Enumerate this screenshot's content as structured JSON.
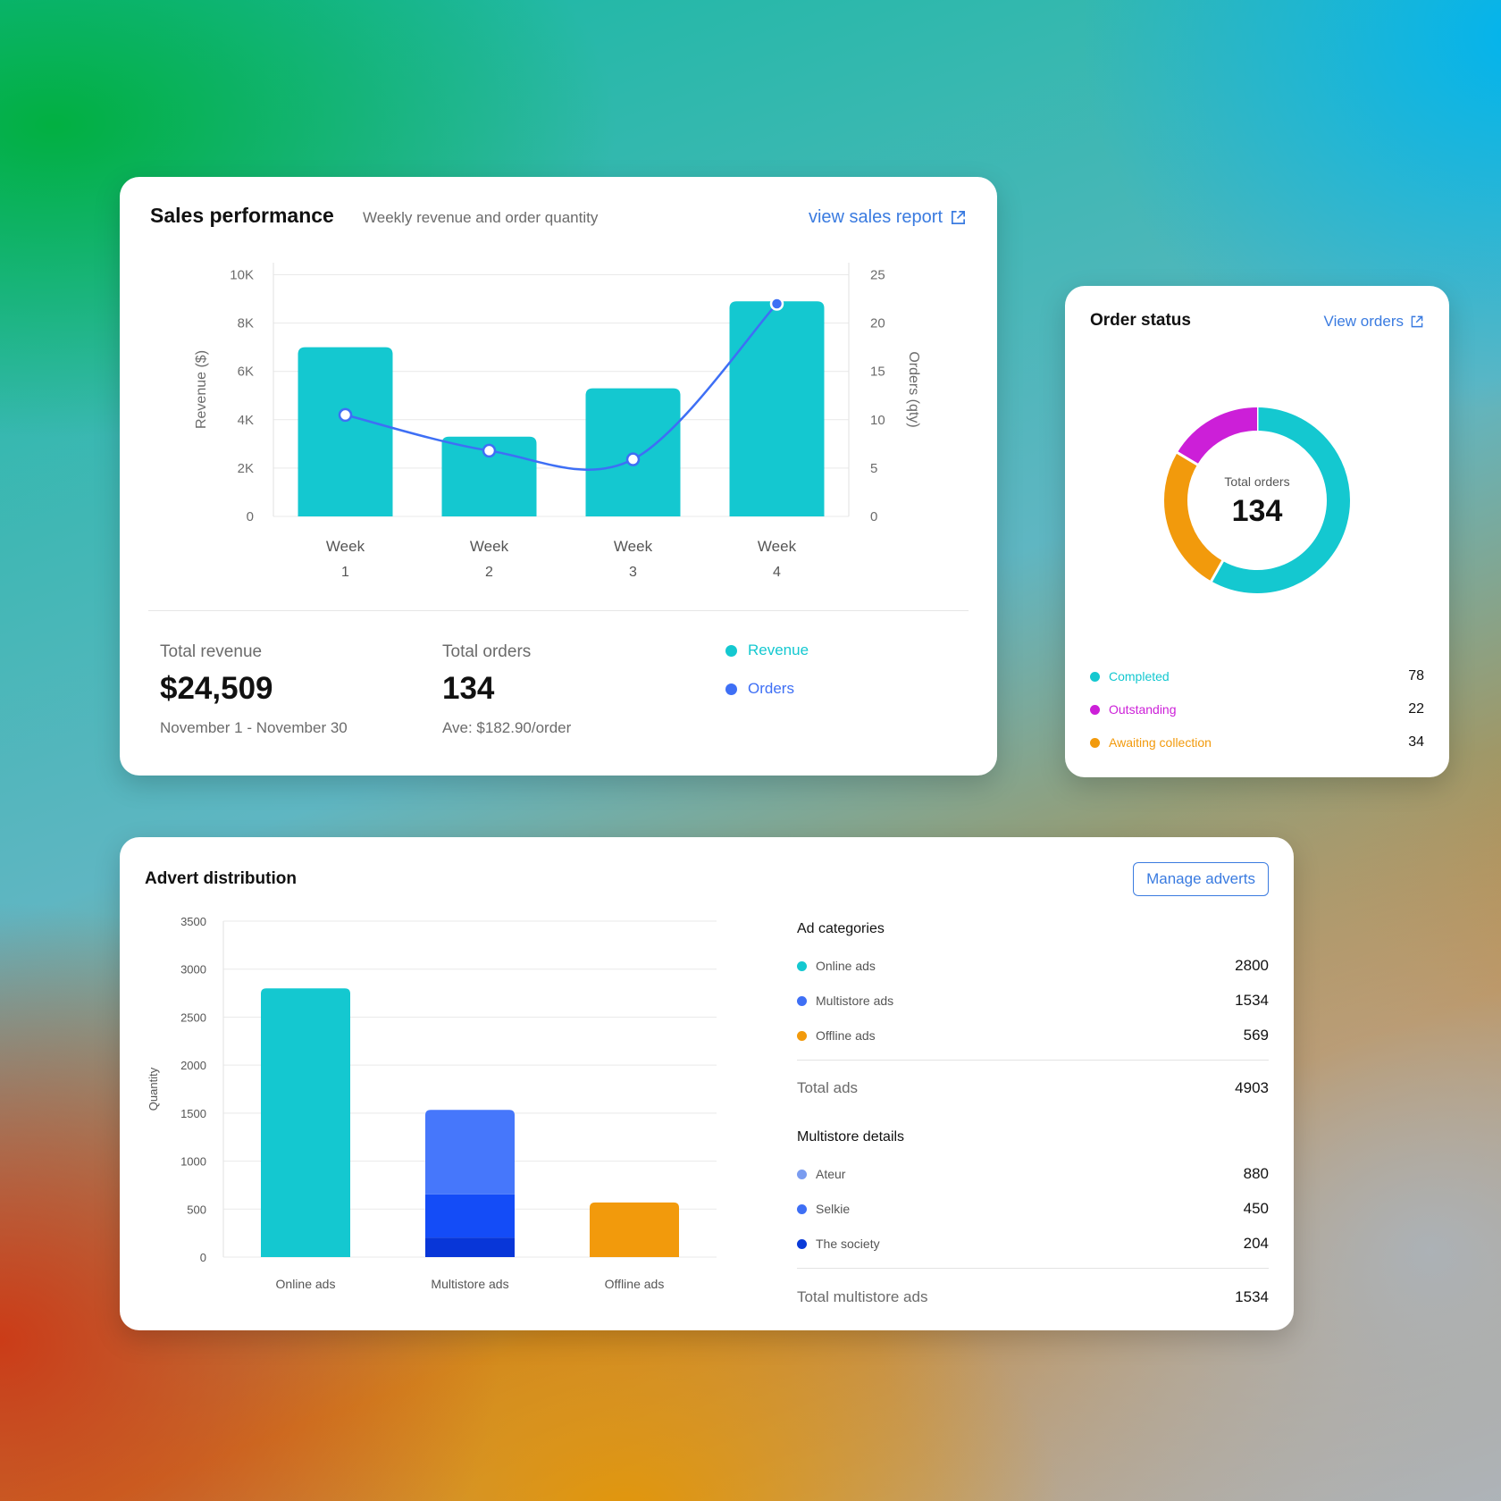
{
  "colors": {
    "teal": "#14c8d0",
    "blue": "#3e6ff5",
    "magenta": "#cc1fd8",
    "orange": "#f29a0c",
    "link": "#3a7be0",
    "multi_light": "#4677fb",
    "multi_mid": "#144cf7",
    "multi_dark": "#0836d8",
    "ateur": "#7a9cf0",
    "selkie": "#3e6ff5",
    "society": "#0a3ad8"
  },
  "icons": {
    "external_link": "external-link-icon",
    "legend_dot": "legend-dot-icon"
  },
  "sales": {
    "title": "Sales performance",
    "subtitle": "Weekly revenue and order quantity",
    "link": "view sales report",
    "total_revenue_label": "Total revenue",
    "total_revenue": "$24,509",
    "date_range": "November 1 - November 30",
    "total_orders_label": "Total orders",
    "total_orders": "134",
    "average": "Ave: $182.90/order",
    "legend": [
      {
        "label": "Revenue",
        "color": "#14c8d0"
      },
      {
        "label": "Orders",
        "color": "#3e6ff5"
      }
    ]
  },
  "orders": {
    "title": "Order status",
    "link": "View orders",
    "center_label": "Total orders",
    "center_value": "134",
    "rows": [
      {
        "label": "Completed",
        "value": "78",
        "color": "#14c8d0"
      },
      {
        "label": "Outstanding",
        "value": "22",
        "color": "#cc1fd8"
      },
      {
        "label": "Awaiting collection",
        "value": "34",
        "color": "#f29a0c"
      }
    ]
  },
  "advert": {
    "title": "Advert distribution",
    "button": "Manage adverts",
    "categories_title": "Ad categories",
    "categories": [
      {
        "label": "Online ads",
        "value": "2800",
        "color": "#14c8d0"
      },
      {
        "label": "Multistore ads",
        "value": "1534",
        "color": "#3e6ff5"
      },
      {
        "label": "Offline ads",
        "value": "569",
        "color": "#f29a0c"
      }
    ],
    "total_label": "Total ads",
    "total_value": "4903",
    "multistore_title": "Multistore details",
    "multistore": [
      {
        "label": "Ateur",
        "value": "880",
        "color": "#7a9cf0"
      },
      {
        "label": "Selkie",
        "value": "450",
        "color": "#3e6ff5"
      },
      {
        "label": "The society",
        "value": "204",
        "color": "#0a3ad8"
      }
    ],
    "multistore_total_label": "Total multistore ads",
    "multistore_total_value": "1534"
  },
  "chart_data": [
    {
      "type": "bar",
      "categories": [
        "Week 1",
        "Week 2",
        "Week 3",
        "Week 4"
      ],
      "category_lines": [
        [
          "Week",
          "1"
        ],
        [
          "Week",
          "2"
        ],
        [
          "Week",
          "3"
        ],
        [
          "Week",
          "4"
        ]
      ],
      "series": [
        {
          "name": "Revenue",
          "type": "bar",
          "axis": "left",
          "values": [
            7000,
            3300,
            5300,
            8900
          ]
        },
        {
          "name": "Orders",
          "type": "line",
          "axis": "right",
          "values": [
            10.5,
            6.8,
            5.9,
            22
          ]
        }
      ],
      "xlabel": "",
      "ylabel": "Revenue ($)",
      "y2label": "Orders (qty)",
      "ylim": [
        0,
        10500
      ],
      "y2lim": [
        0,
        26.25
      ],
      "yticks": [
        0,
        2000,
        4000,
        6000,
        8000,
        10000
      ],
      "ytick_labels": [
        "0",
        "2K",
        "4K",
        "6K",
        "8K",
        "10K"
      ],
      "y2ticks": [
        0,
        5,
        10,
        15,
        20,
        25
      ],
      "grid": true
    },
    {
      "type": "pie",
      "categories": [
        "Completed",
        "Outstanding",
        "Awaiting collection"
      ],
      "values": [
        78,
        22,
        34
      ],
      "donut": true
    },
    {
      "type": "bar",
      "categories": [
        "Online ads",
        "Multistore ads",
        "Offline ads"
      ],
      "stacked_segments": [
        [
          2800
        ],
        [
          204,
          450,
          880
        ],
        [
          569
        ]
      ],
      "values": [
        2800,
        1534,
        569
      ],
      "ylabel": "Quantity",
      "ylim": [
        0,
        3500
      ],
      "yticks": [
        0,
        500,
        1000,
        1500,
        2000,
        2500,
        3000,
        3500
      ],
      "grid": true
    }
  ]
}
